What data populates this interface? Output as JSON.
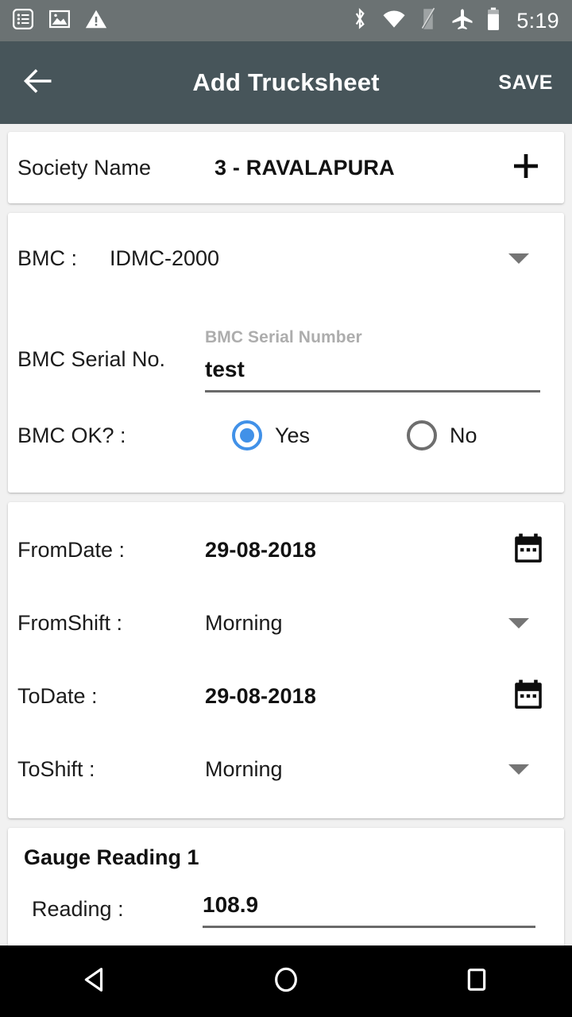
{
  "status_bar": {
    "background": "#6b7273",
    "clock": "5:19",
    "left_icons": [
      {
        "name": "checklist-notification-icon"
      },
      {
        "name": "image-notification-icon"
      },
      {
        "name": "warning-notification-icon"
      }
    ],
    "right_icons": [
      {
        "name": "bluetooth-icon"
      },
      {
        "name": "wifi-icon"
      },
      {
        "name": "no-sim-icon"
      },
      {
        "name": "airplane-mode-icon"
      },
      {
        "name": "battery-icon"
      }
    ]
  },
  "app_bar": {
    "background": "#47555a",
    "title": "Add Trucksheet",
    "back_icon": "arrow-left-icon",
    "save_label": "SAVE"
  },
  "society": {
    "label": "Society Name",
    "value": "3 - RAVALAPURA",
    "add_icon": "plus-icon"
  },
  "bmc": {
    "label": "BMC :",
    "value": "IDMC-2000",
    "dropdown_icon": "chevron-down-icon",
    "serial_label": "BMC Serial No.",
    "serial_hint": "BMC Serial Number",
    "serial_value": "test",
    "ok_label": "BMC OK? :",
    "options": [
      {
        "label": "Yes",
        "checked": true
      },
      {
        "label": "No",
        "checked": false
      }
    ],
    "accent_color": "#4191e8"
  },
  "dates": {
    "from_date_label": "FromDate :",
    "from_date_value": "29-08-2018",
    "from_shift_label": "FromShift :",
    "from_shift_value": "Morning",
    "to_date_label": "ToDate :",
    "to_date_value": "29-08-2018",
    "to_shift_label": "ToShift :",
    "to_shift_value": "Morning",
    "calendar_icon": "calendar-icon",
    "dropdown_icon": "chevron-down-icon"
  },
  "gauge": {
    "title": "Gauge Reading 1",
    "reading_label": "Reading :",
    "reading_value": "108.9"
  },
  "nav_bar": {
    "background": "#000000",
    "buttons": [
      {
        "name": "back-nav-button"
      },
      {
        "name": "home-nav-button"
      },
      {
        "name": "recents-nav-button"
      }
    ]
  }
}
